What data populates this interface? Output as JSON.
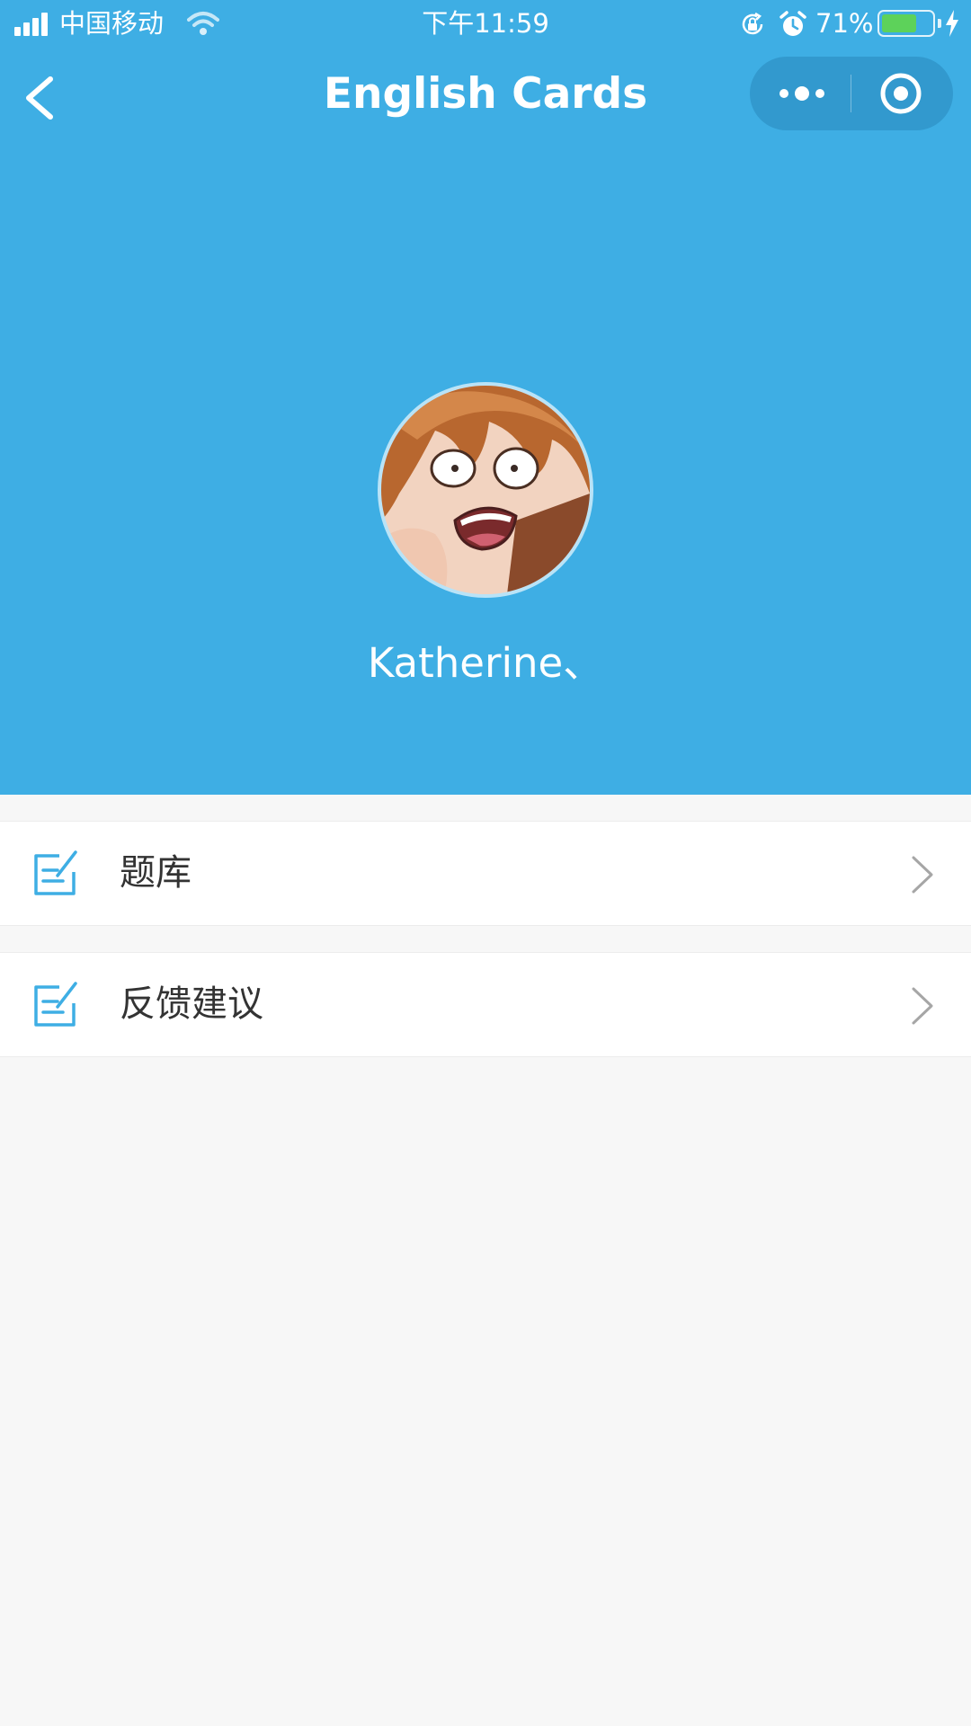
{
  "status_bar": {
    "carrier": "中国移动",
    "time": "下午11:59",
    "battery_percent": "71%",
    "battery_level": 0.71,
    "icons": [
      "signal-icon",
      "wifi-icon",
      "rotation-lock-icon",
      "alarm-icon",
      "battery-icon",
      "charging-icon"
    ]
  },
  "nav": {
    "title": "English Cards",
    "back_icon": "chevron-left-icon",
    "more_icon": "more-dots-icon",
    "close_icon": "target-circle-icon"
  },
  "profile": {
    "username": "Katherine、",
    "avatar_icon": "avatar"
  },
  "menu": {
    "items": [
      {
        "label": "题库",
        "icon": "edit-icon",
        "arrow": "chevron-right-icon"
      },
      {
        "label": "反馈建议",
        "icon": "edit-icon",
        "arrow": "chevron-right-icon"
      }
    ]
  },
  "colors": {
    "header_bg": "#3eaee4",
    "page_bg": "#f7f7f7",
    "icon_accent": "#3eaee4",
    "battery_fill": "#5dd25a"
  }
}
